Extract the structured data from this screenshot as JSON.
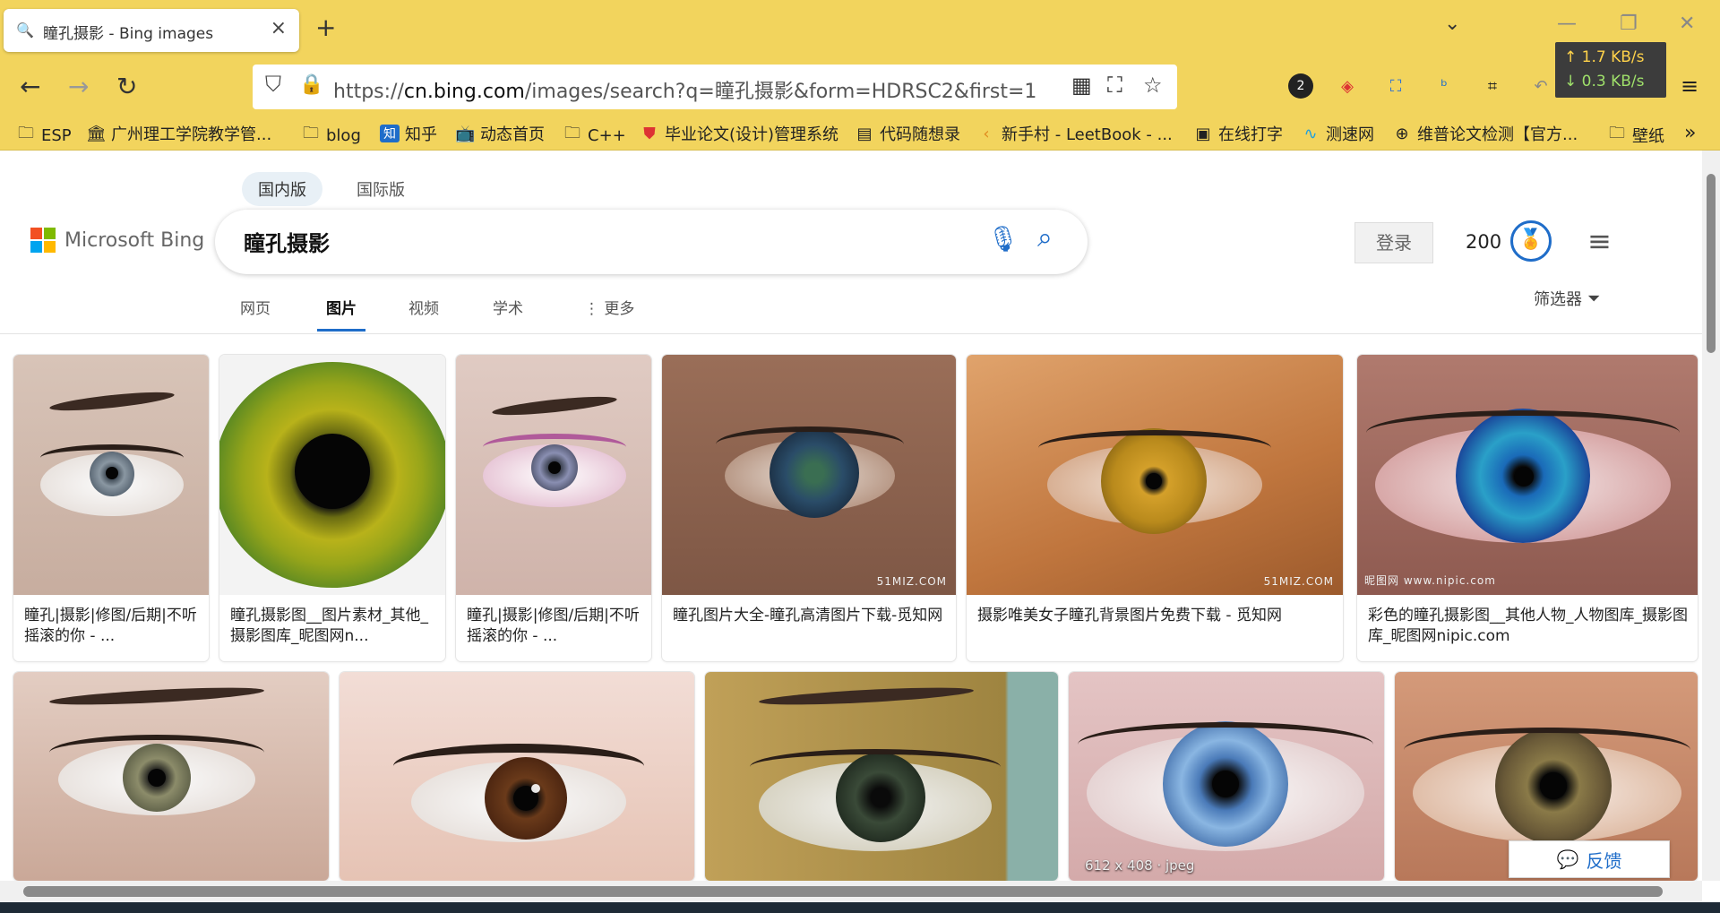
{
  "tab": {
    "title": "瞳孔摄影 - Bing images",
    "favicon": "search-icon"
  },
  "window": {
    "new_tab": "+",
    "list_tabs": "⌄",
    "minimize": "—",
    "restore": "❐",
    "close": "✕"
  },
  "nav": {
    "url_host": "cn.bing.com",
    "url_prefix": "https://",
    "url_path": "/images/search?q=瞳孔摄影&form=HDRSC2&first=1"
  },
  "netspeed": {
    "up": "↑ 1.7 KB/s",
    "down": "↓ 0.3 KB/s"
  },
  "bookmarks": [
    {
      "label": "ESP",
      "icon": "folder-icon"
    },
    {
      "label": "广州理工学院教学管...",
      "icon": "building-icon"
    },
    {
      "label": "blog",
      "icon": "folder-icon"
    },
    {
      "label": "知乎",
      "icon": "zhihu-icon"
    },
    {
      "label": "动态首页",
      "icon": "bilibili-icon"
    },
    {
      "label": "C++",
      "icon": "folder-icon"
    },
    {
      "label": "毕业论文(设计)管理系统",
      "icon": "shield-icon"
    },
    {
      "label": "代码随想录",
      "icon": "doc-icon"
    },
    {
      "label": "新手村 - LeetBook - ...",
      "icon": "leetcode-icon"
    },
    {
      "label": "在线打字",
      "icon": "typing-icon"
    },
    {
      "label": "测速网",
      "icon": "speed-icon"
    },
    {
      "label": "维普论文检测【官方...",
      "icon": "globe-icon"
    },
    {
      "label": "壁纸",
      "icon": "folder-icon"
    },
    {
      "label": "»",
      "icon": "more-icon"
    }
  ],
  "bing": {
    "scope_domestic": "国内版",
    "scope_intl": "国际版",
    "logo_text": "Microsoft Bing",
    "query": "瞳孔摄影",
    "login": "登录",
    "points": "200",
    "verticals": [
      "网页",
      "图片",
      "视频",
      "学术",
      "⋮ 更多"
    ],
    "active_vertical": "图片",
    "filter": "筛选器",
    "feedback": "反馈"
  },
  "results_row1": [
    {
      "caption": "瞳孔|摄影|修图/后期|不听摇滚的你 - ..."
    },
    {
      "caption": "瞳孔摄影图__图片素材_其他_摄影图库_昵图网n..."
    },
    {
      "caption": "瞳孔|摄影|修图/后期|不听摇滚的你 - ..."
    },
    {
      "caption": "瞳孔图片大全-瞳孔高清图片下载-觅知网",
      "watermark": "51MIZ.COM"
    },
    {
      "caption": "摄影唯美女子瞳孔背景图片免费下载 - 觅知网",
      "watermark": "51MIZ.COM"
    },
    {
      "caption": "彩色的瞳孔摄影图__其他人物_人物图库_摄影图库_昵图网nipic.com",
      "watermark": "昵图网 www.nipic.com"
    }
  ],
  "results_row2": [
    {
      "meta": ""
    },
    {
      "meta": ""
    },
    {
      "meta": ""
    },
    {
      "meta": "612 x 408 · jpeg"
    },
    {
      "meta": ""
    }
  ],
  "colors": {
    "chrome": "#f2d45d",
    "accent": "#1f6dc9"
  }
}
